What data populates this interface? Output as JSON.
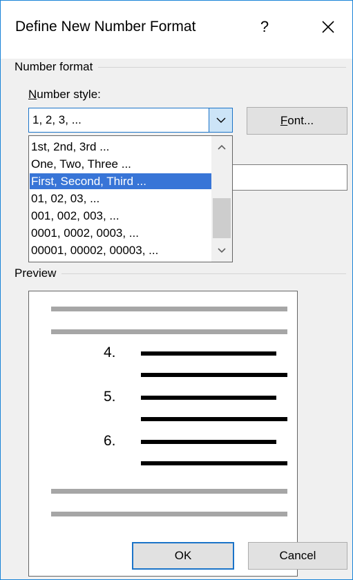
{
  "dialog": {
    "title": "Define New Number Format",
    "help_label": "?",
    "close_icon": "close-icon"
  },
  "number_format": {
    "group_label": "Number format",
    "number_style_label_accel": "N",
    "number_style_label_rest": "umber style:",
    "selected_value": "1, 2, 3, ...",
    "font_button_accel": "F",
    "font_button_rest": "ont..."
  },
  "dropdown": {
    "items": [
      "1st, 2nd, 3rd ...",
      "One, Two, Three ...",
      "First, Second, Third ...",
      "01, 02, 03, ...",
      "001, 002, 003, ...",
      "0001, 0002, 0003, ...",
      "00001, 00002, 00003, ..."
    ],
    "highlighted": "First, Second, Third ..."
  },
  "preview": {
    "group_label": "Preview",
    "numbers": [
      "4.",
      "5.",
      "6."
    ]
  },
  "buttons": {
    "ok": "OK",
    "cancel": "Cancel"
  },
  "colors": {
    "accent": "#1a73c8",
    "highlight": "#3875d7"
  }
}
